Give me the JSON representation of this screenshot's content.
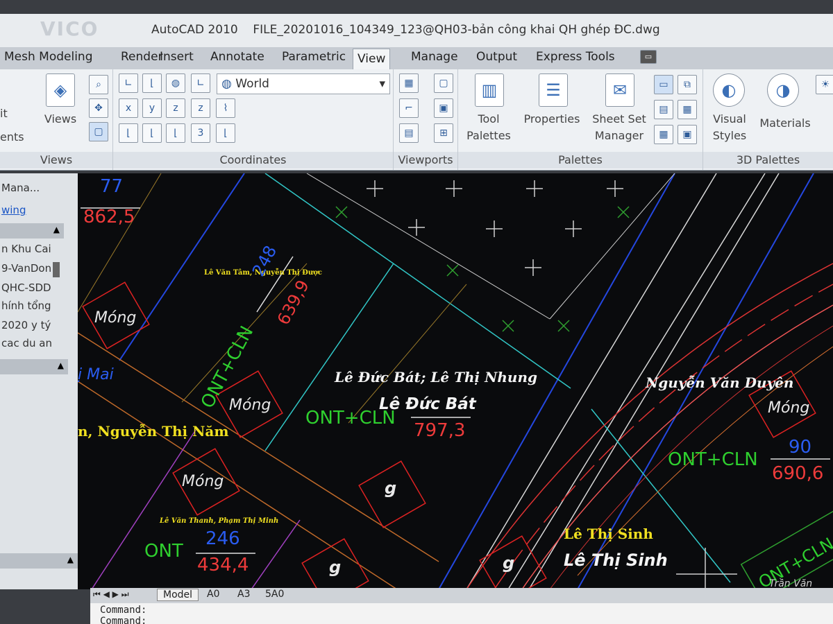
{
  "titlebar": {
    "app": "AutoCAD 2010",
    "file": "FILE_20201016_104349_123@QH03-bản công khai QH ghép ĐC.dwg",
    "watermark": "VICO"
  },
  "tabs": [
    "Mesh Modeling",
    "Render",
    "Insert",
    "Annotate",
    "Parametric",
    "View",
    "Manage",
    "Output",
    "Express Tools"
  ],
  "active_tab": "View",
  "ribbon": {
    "views_panel": {
      "label": "Views",
      "button": "Views",
      "left_items": [
        "it",
        "ents"
      ]
    },
    "coordinates_panel": {
      "label": "Coordinates",
      "ucs_value": "World"
    },
    "viewports_panel": {
      "label": "Viewports"
    },
    "palettes_panel": {
      "label": "Palettes",
      "tool_palettes": "Tool Palettes",
      "properties": "Properties",
      "sheet_set": "Sheet Set Manager"
    },
    "palettes3d_panel": {
      "label": "3D Palettes",
      "visual_styles": "Visual Styles",
      "materials": "Materials"
    }
  },
  "left_panel": {
    "header": "Mana...",
    "link": "wing",
    "items": [
      "n Khu Cai",
      "9-VanDon",
      "QHC-SDD",
      "hính tổng",
      "2020 y tý",
      "cac du an"
    ]
  },
  "drawing": {
    "labels": {
      "n77": "77",
      "n862": "862,5",
      "owner1": "Lê Văn Tâm, Nguyễn Thị Được",
      "n248": "248",
      "n639": "639,9",
      "ontcln1": "ONT+CLN",
      "mong1": "Móng",
      "mong2": "Móng",
      "mong3": "Móng",
      "mong4": "Móng",
      "mai": "ị Mai",
      "nam": "n, Nguyễn Thị Năm",
      "owner2": "Lê Đức Bát; Lê Thị Nhung",
      "owner2b": "Lê Đức Bát",
      "ontcln2": "ONT+CLN",
      "n797": "797,3",
      "owner3": "Nguyễn Văn Duyên",
      "ontcln3": "ONT+CLN",
      "n90": "90",
      "n690": "690,6",
      "owner4": "Lê Văn Thanh, Phạm Thị Minh",
      "ont": "ONT",
      "n246": "246",
      "n434": "434,4",
      "owner5": "Lê Thị Sinh",
      "owner5b": "Lê Thị Sinh",
      "g1": "g",
      "g2": "g",
      "g3": "g",
      "ontcln4": "ONT+CLN",
      "n_partial": "Trần Văn"
    }
  },
  "model_tabs": [
    "Model",
    "A0",
    "A3",
    "5A0"
  ],
  "command": {
    "line1": "Command:",
    "line2": "Command:"
  }
}
